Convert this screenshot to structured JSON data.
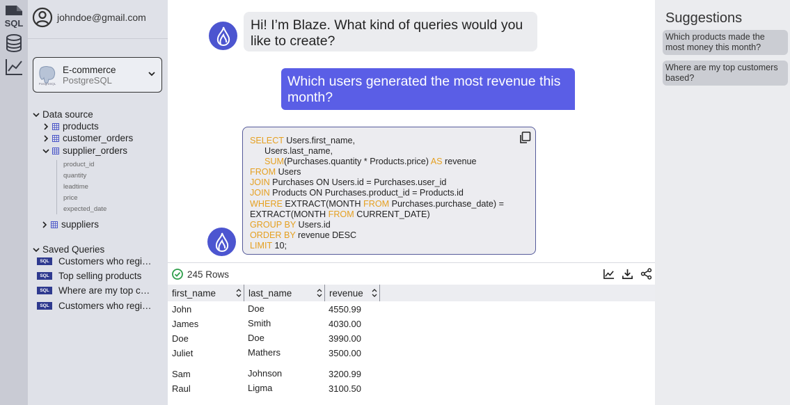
{
  "rail": {
    "sql_label": "SQL"
  },
  "account": {
    "email": "johndoe@gmail.com"
  },
  "database": {
    "name": "E-commerce",
    "type": "PostgreSQL",
    "logo_text": "PostgreSQL"
  },
  "data_source": {
    "title": "Data source",
    "tables": [
      {
        "name": "products"
      },
      {
        "name": "customer_orders"
      },
      {
        "name": "supplier_orders",
        "columns": [
          "product_id",
          "quantity",
          "leadtime",
          "price",
          "expected_date"
        ]
      },
      {
        "name": "suppliers"
      }
    ]
  },
  "saved_queries": {
    "title": "Saved Queries",
    "badge": "SQL",
    "items": [
      "Customers who registered",
      "Top selling products",
      "Where are my top customers",
      "Customers who registered"
    ]
  },
  "chat": {
    "bot_message": "Hi! I’m Blaze. What kind of queries would you like to create?",
    "user_message": "Which users generated the most revenue this month?",
    "code_lines": [
      [
        {
          "t": "SELECT",
          "k": 1
        },
        {
          "t": " Users.first_name,"
        }
      ],
      [
        {
          "t": "      Users.last_name,"
        }
      ],
      [
        {
          "t": "      "
        },
        {
          "t": "SUM",
          "k": 1
        },
        {
          "t": "(Purchases.quantity * Products.price) "
        },
        {
          "t": "AS",
          "k": 1
        },
        {
          "t": " revenue"
        }
      ],
      [
        {
          "t": "FROM",
          "k": 1
        },
        {
          "t": " Users"
        }
      ],
      [
        {
          "t": "JOIN",
          "k": 1
        },
        {
          "t": " Purchases ON Users.id = Purchases.user_id"
        }
      ],
      [
        {
          "t": "JOIN",
          "k": 1
        },
        {
          "t": " Products ON Purchases.product_id = Products.id"
        }
      ],
      [
        {
          "t": "WHERE",
          "k": 1
        },
        {
          "t": " EXTRACT(MONTH "
        },
        {
          "t": "FROM",
          "k": 1
        },
        {
          "t": " Purchases.purchase_date) ="
        }
      ],
      [
        {
          "t": "EXTRACT(MONTH "
        },
        {
          "t": "FROM",
          "k": 1
        },
        {
          "t": " CURRENT_DATE)"
        }
      ],
      [
        {
          "t": "GROUP BY",
          "k": 1
        },
        {
          "t": " Users.id"
        }
      ],
      [
        {
          "t": "ORDER BY",
          "k": 1
        },
        {
          "t": " revenue DESC"
        }
      ],
      [
        {
          "t": "LIMIT",
          "k": 1
        },
        {
          "t": " 10;"
        }
      ]
    ]
  },
  "results": {
    "row_count": "245 Rows",
    "columns": [
      "first_name",
      "last_name",
      "revenue"
    ],
    "rows": [
      [
        "John",
        "Doe",
        "4550.99"
      ],
      [
        "James",
        "Smith",
        "4030.00"
      ],
      [
        "Doe",
        "Doe",
        "3990.00"
      ],
      [
        "Juliet",
        "Mathers",
        "3500.00"
      ],
      [
        "Sam",
        "Johnson",
        "3200.99"
      ],
      [
        "Raul",
        "Ligma",
        "3100.50"
      ]
    ]
  },
  "suggestions": {
    "title": "Suggestions",
    "items": [
      "Which products made the most money this month?",
      "Where are my top customers based?"
    ]
  },
  "colors": {
    "accent": "#5a5ee6",
    "keyword": "#e5a021",
    "badge": "#2f3a8f",
    "success": "#2e9e4a"
  }
}
